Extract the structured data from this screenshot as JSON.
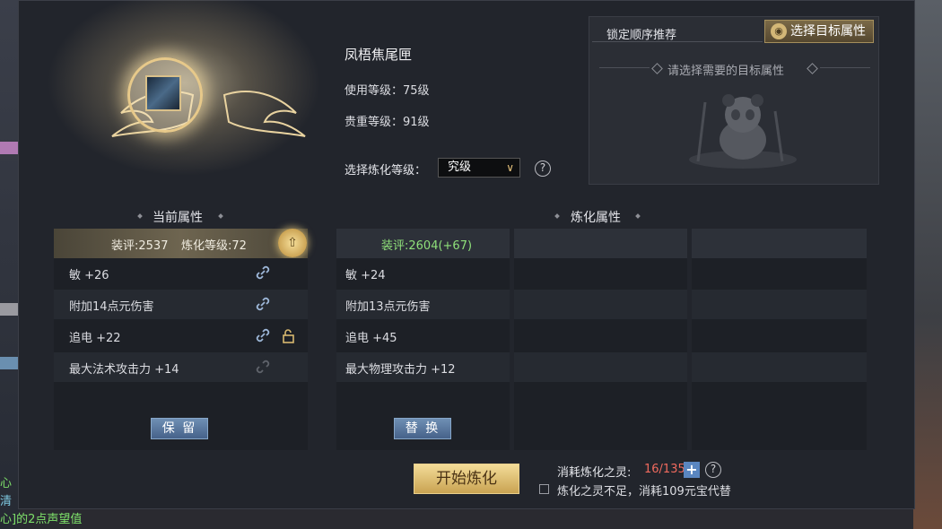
{
  "item": {
    "name": "凤梧焦尾匣",
    "use_level": "使用等级：75级",
    "value_level": "贵重等级：91级"
  },
  "refine_level": {
    "label": "选择炼化等级：",
    "selected": "究级"
  },
  "recommend": {
    "label": "锁定顺序推荐",
    "button": "选择目标属性",
    "hint": "请选择需要的目标属性"
  },
  "current": {
    "title": "当前属性",
    "score": "装评:2537",
    "refine_level": "炼化等级:72",
    "attributes": [
      "敏 +26",
      "附加14点元伤害",
      "追电 +22",
      "最大法术攻击力 +14"
    ],
    "keep_button": "保 留"
  },
  "refined": {
    "title": "炼化属性",
    "score": "装评:2604(+67)",
    "attributes": [
      "敏 +24",
      "附加13点元伤害",
      "追电 +45",
      "最大物理攻击力 +12"
    ],
    "replace_button": "替 换"
  },
  "bottom": {
    "start_button": "开始炼化",
    "cost_label": "消耗炼化之灵:",
    "cost_value": "16/135",
    "substitute_label": "炼化之灵不足，消耗109元宝代替"
  },
  "background_chat": {
    "line1": "心",
    "line2": "清",
    "line3": "心]的2点声望值"
  },
  "colors": {
    "score_green": "#8fe07a",
    "cost_red": "#f06a5e",
    "gold": "#e7c98a",
    "blue_button": "#5a86c0"
  }
}
